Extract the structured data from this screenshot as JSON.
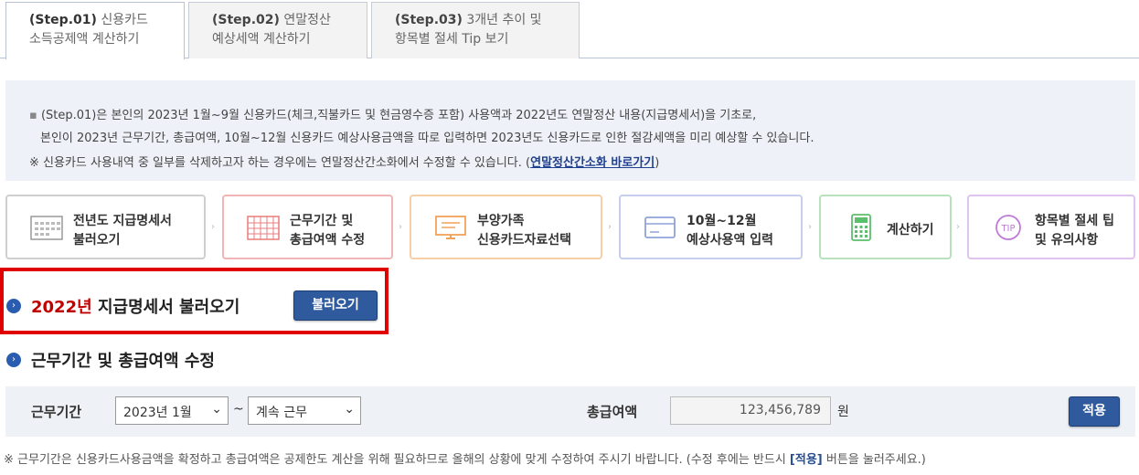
{
  "tabs": [
    {
      "step": "(Step.01)",
      "rest1": "신용카드",
      "line2": "소득공제액 계산하기",
      "active": true
    },
    {
      "step": "(Step.02)",
      "rest1": "연말정산",
      "line2": "예상세액 계산하기",
      "active": false
    },
    {
      "step": "(Step.03)",
      "rest1": "3개년 추이 및",
      "line2": "항목별 절세 Tip 보기",
      "active": false
    }
  ],
  "info": {
    "line1": "(Step.01)은 본인의 2023년 1월~9월 신용카드(체크,직불카드 및 현금영수증 포함) 사용액과 2022년도 연말정산 내용(지급명세서)을 기초로,",
    "line2": "본인이 2023년 근무기간, 총급여액, 10월~12월 신용카드 예상사용금액을 따로 입력하면 2023년도 신용카드로 인한 절감세액을 미리 예상할 수 있습니다.",
    "line3": "※ 신용카드 사용내역 중 일부를 삭제하고자 하는 경우에는 연말정산간소화에서 수정할 수 있습니다.",
    "link": "연말정산간소화 바로가기"
  },
  "steps": [
    {
      "line1": "전년도 지급명세서",
      "line2": "불러오기",
      "icon": "calendar-icon",
      "color": "#cccccc"
    },
    {
      "line1": "근무기간 및",
      "line2": "총급여액 수정",
      "icon": "grid-calendar-icon",
      "color": "#f2a7a7"
    },
    {
      "line1": "부양가족",
      "line2": "신용카드자료선택",
      "icon": "monitor-icon",
      "color": "#f6c79a"
    },
    {
      "line1": "10월~12월",
      "line2": "예상사용액 입력",
      "icon": "credit-card-icon",
      "color": "#b9c6ea"
    },
    {
      "line1": "계산하기",
      "line2": "",
      "icon": "calculator-icon",
      "color": "#a8dcb0"
    },
    {
      "line1": "항목별 절세 팁",
      "line2": "및 유의사항",
      "icon": "tip-icon",
      "color": "#d9b5e8"
    }
  ],
  "section1": {
    "year": "2022년",
    "title": "지급명세서 불러오기",
    "button": "불러오기"
  },
  "section2": {
    "title": "근무기간 및 총급여액 수정"
  },
  "form": {
    "period_label": "근무기간",
    "start": "2023년 1월",
    "tilde": "~",
    "end": "계속 근무",
    "salary_label": "총급여액",
    "salary_value": "123,456,789",
    "unit": "원",
    "apply": "적용"
  },
  "note": {
    "before": "※ 근무기간은 신용카드사용금액을 확정하고 총급여액은 공제한도 계산을 위해 필요하므로 올해의 상황에 맞게 수정하여 주시기 바랍니다. (수정 후에는 반드시 ",
    "bold": "[적용]",
    "after": " 버튼을 눌러주세요.)"
  },
  "colors": {
    "accent": "#2f5a9d",
    "highlight": "#e10000",
    "info_bg": "#eef2f8"
  }
}
